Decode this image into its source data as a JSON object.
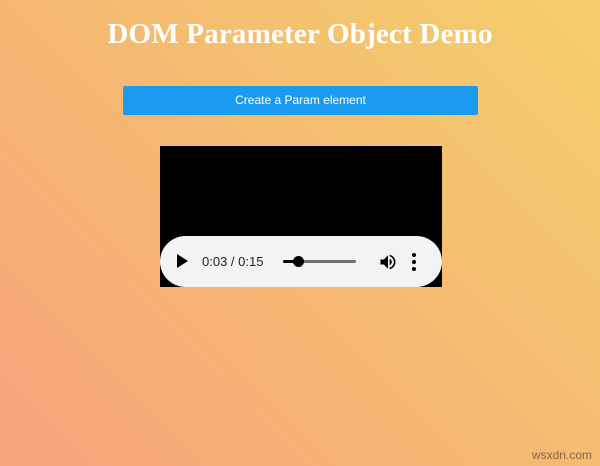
{
  "page": {
    "title": "DOM Parameter Object Demo"
  },
  "toolbar": {
    "create_label": "Create a Param element"
  },
  "player": {
    "current_time": "0:03",
    "duration": "0:15",
    "time_text": "0:03 / 0:15",
    "progress_fraction": 0.2,
    "play_icon": "play-icon",
    "volume_icon": "volume-icon",
    "more_icon": "more-vertical-icon"
  },
  "colors": {
    "button": "#1a9bf0",
    "title": "#ffffff",
    "background_start": "#f6a57c",
    "background_end": "#f4cf6c"
  },
  "watermark": {
    "text": "wsxdn.com"
  }
}
